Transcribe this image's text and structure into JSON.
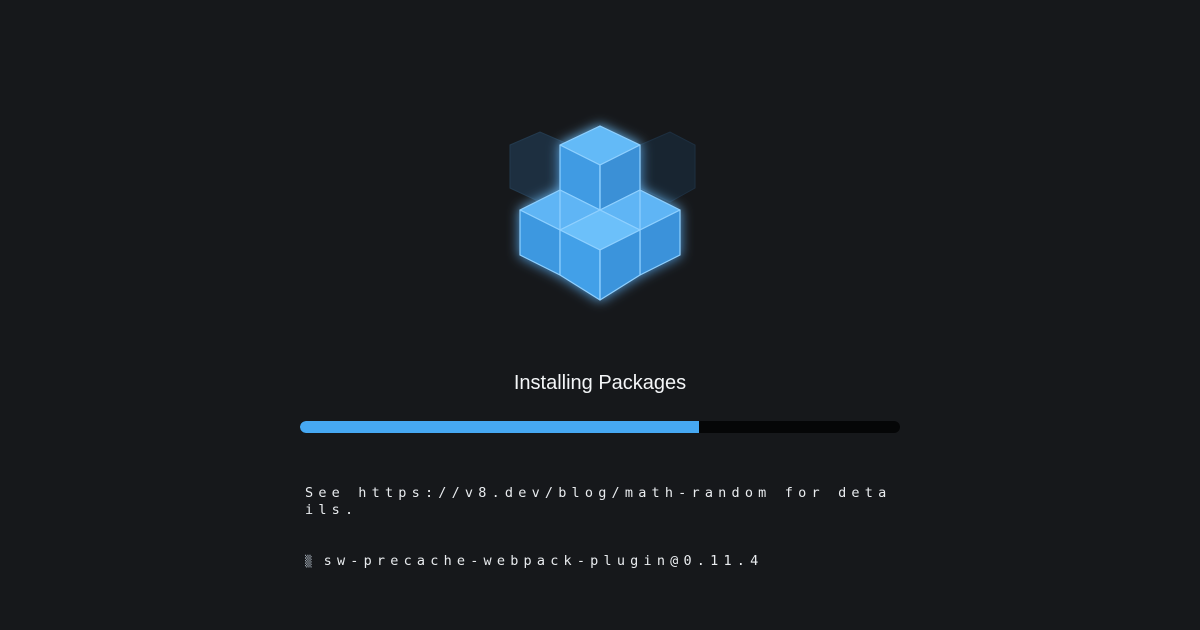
{
  "title": "Installing Packages",
  "progress": 0.665,
  "colors": {
    "background": "#16181b",
    "accent": "#46a8f2",
    "track": "#050607"
  },
  "logo": {
    "icon": "stacked-cubes-icon"
  },
  "log": {
    "message": "See https://v8.dev/blog/math-random for details.",
    "spinner": "▒",
    "package": "sw-precache-webpack-plugin@0.11.4"
  }
}
